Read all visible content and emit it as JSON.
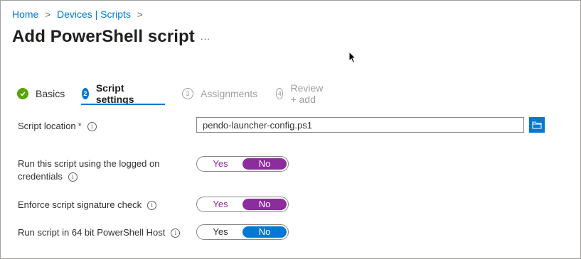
{
  "breadcrumb": {
    "home": "Home",
    "devices": "Devices | Scripts"
  },
  "page": {
    "title": "Add PowerShell script",
    "more": "..."
  },
  "steps": [
    {
      "num": "",
      "label": "Basics",
      "state": "done"
    },
    {
      "num": "2",
      "label": "Script settings",
      "state": "active"
    },
    {
      "num": "3",
      "label": "Assignments",
      "state": "future"
    },
    {
      "num": "4",
      "label": "Review + add",
      "state": "future"
    }
  ],
  "form": {
    "script_location": {
      "label": "Script location",
      "required": "*",
      "value": "pendo-launcher-config.ps1"
    },
    "logged_on": {
      "label_line1": "Run this script using the logged on",
      "label_line2": "credentials",
      "yes": "Yes",
      "no": "No",
      "selected": "No"
    },
    "signature": {
      "label": "Enforce script signature check",
      "yes": "Yes",
      "no": "No",
      "selected": "No"
    },
    "bit64": {
      "label": "Run script in 64 bit PowerShell Host",
      "yes": "Yes",
      "no": "No",
      "selected": "No"
    }
  },
  "icons": {
    "info": "i",
    "browse": "folder-icon",
    "check": "checkmark-icon"
  },
  "colors": {
    "accent": "#0078d4",
    "toggle_purple": "#8c2d9e",
    "success": "#57a300"
  }
}
